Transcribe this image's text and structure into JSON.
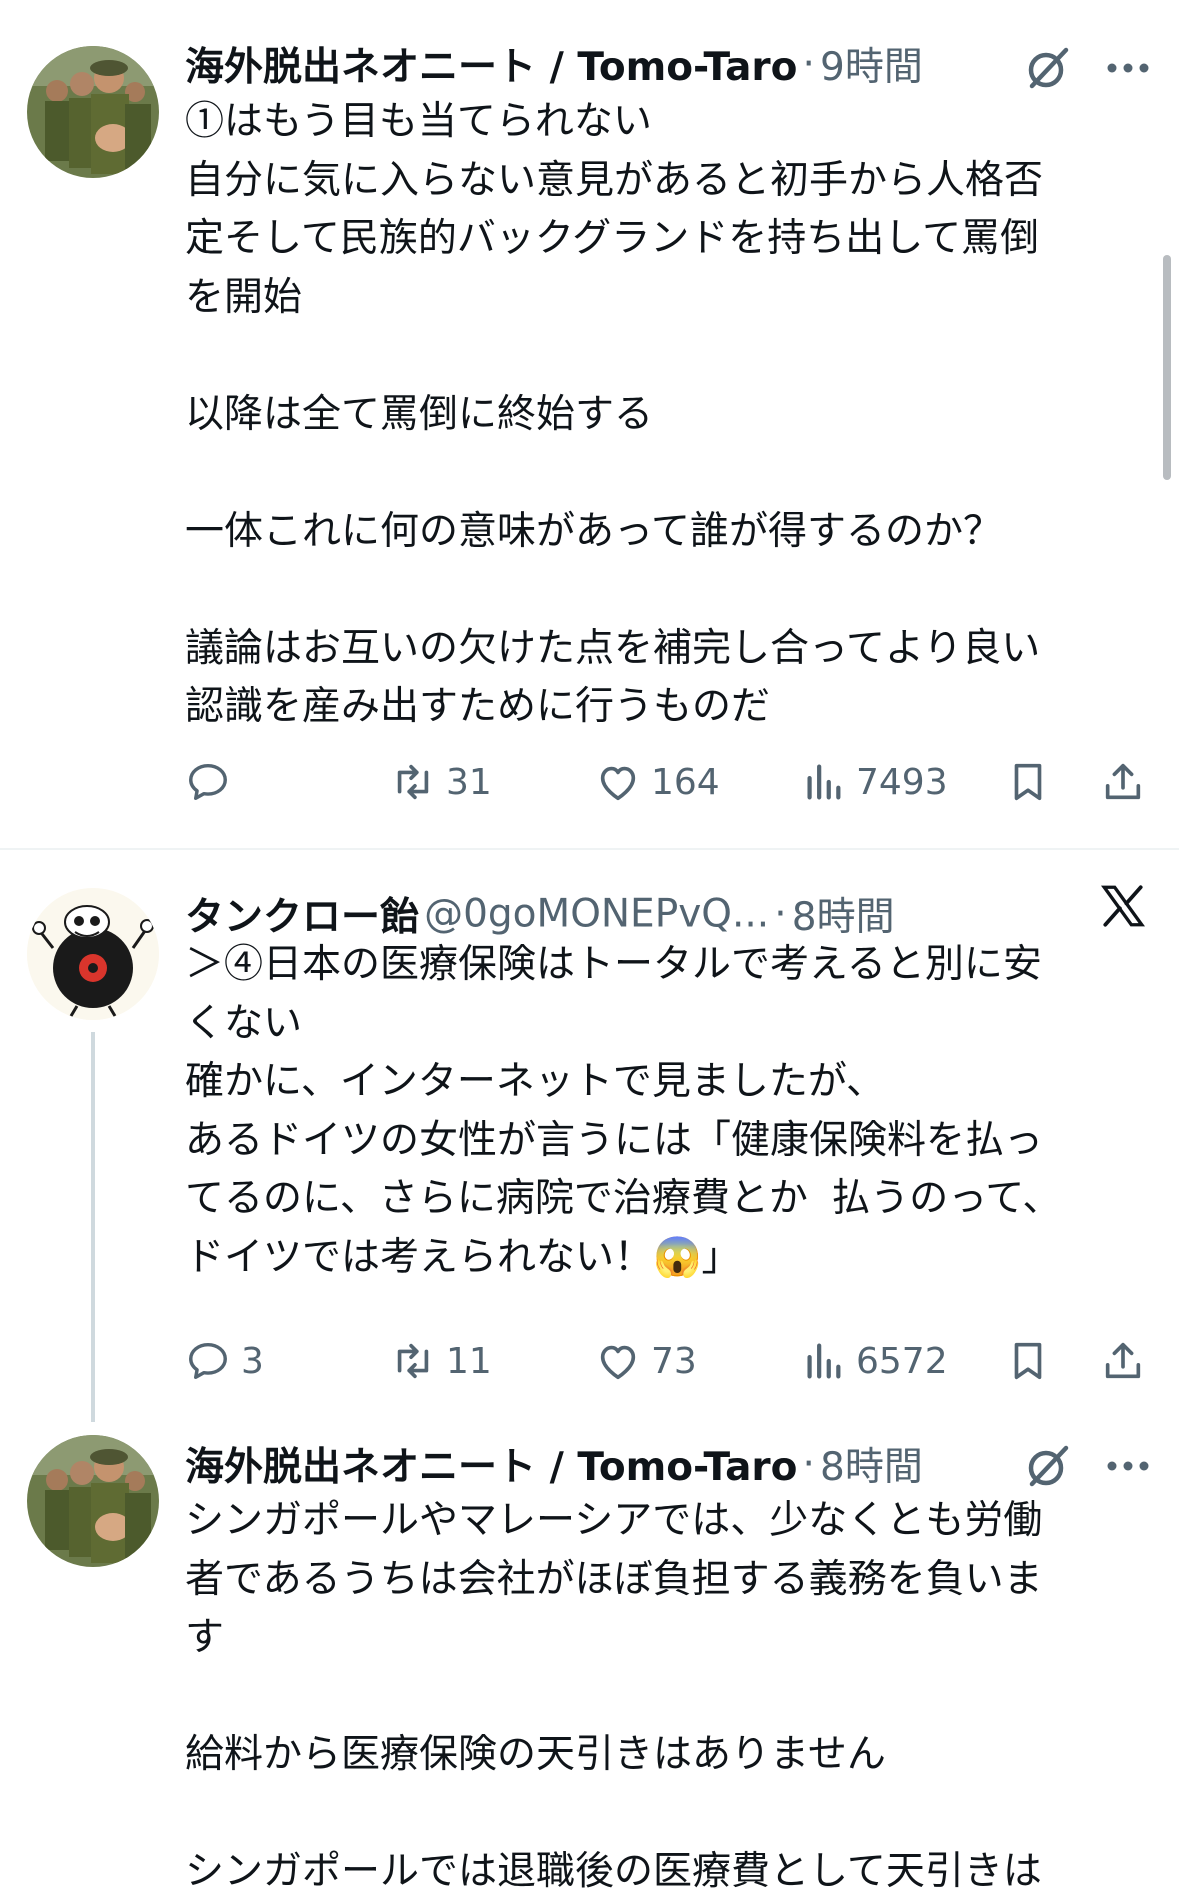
{
  "posts": [
    {
      "name": "海外脱出ネオニート / Tomo-Taro",
      "handle": "",
      "time": "9時間",
      "text": "①はもう目も当てられない\n自分に気に入らない意見があると初手から人格否\n定そして民族的バックグランドを持ち出して罵倒\nを開始\n\n以降は全て罵倒に終始する\n\n一体これに何の意味があって誰が得するのか？\n\n議論はお互いの欠けた点を補完し合ってより良い\n認識を産み出すために行うものだ",
      "replies": "",
      "reposts": "31",
      "likes": "164",
      "views": "7493",
      "badge_icon": "grok-slash-icon"
    },
    {
      "name": "タンクロー飴",
      "handle": "@0goMONEPvQ...",
      "time": "8時間",
      "text": "＞④日本の医療保険はトータルで考えると別に安\nくない\n確かに、インターネットで見ましたが、\nあるドイツの女性が言うには「健康保険料を払っ\nてるのに、さらに病院で治療費とか 払うのって、\nドイツでは考えられない！😱」",
      "replies": "3",
      "reposts": "11",
      "likes": "73",
      "views": "6572",
      "badge_icon": "x-logo-icon"
    },
    {
      "name": "海外脱出ネオニート / Tomo-Taro",
      "handle": "",
      "time": "8時間",
      "text": "シンガポールやマレーシアでは、少なくとも労働\n者であるうちは会社がほぼ負担する義務を負いま\nす\n\n給料から医療保険の天引きはありません\n\nシンガポールでは退職後の医療費として天引きは",
      "badge_icon": "grok-slash-icon"
    }
  ],
  "separator": "·",
  "colors": {
    "text": "#0f1419",
    "secondary": "#536471",
    "divider": "#eff3f4",
    "thread": "#cfd9de"
  }
}
